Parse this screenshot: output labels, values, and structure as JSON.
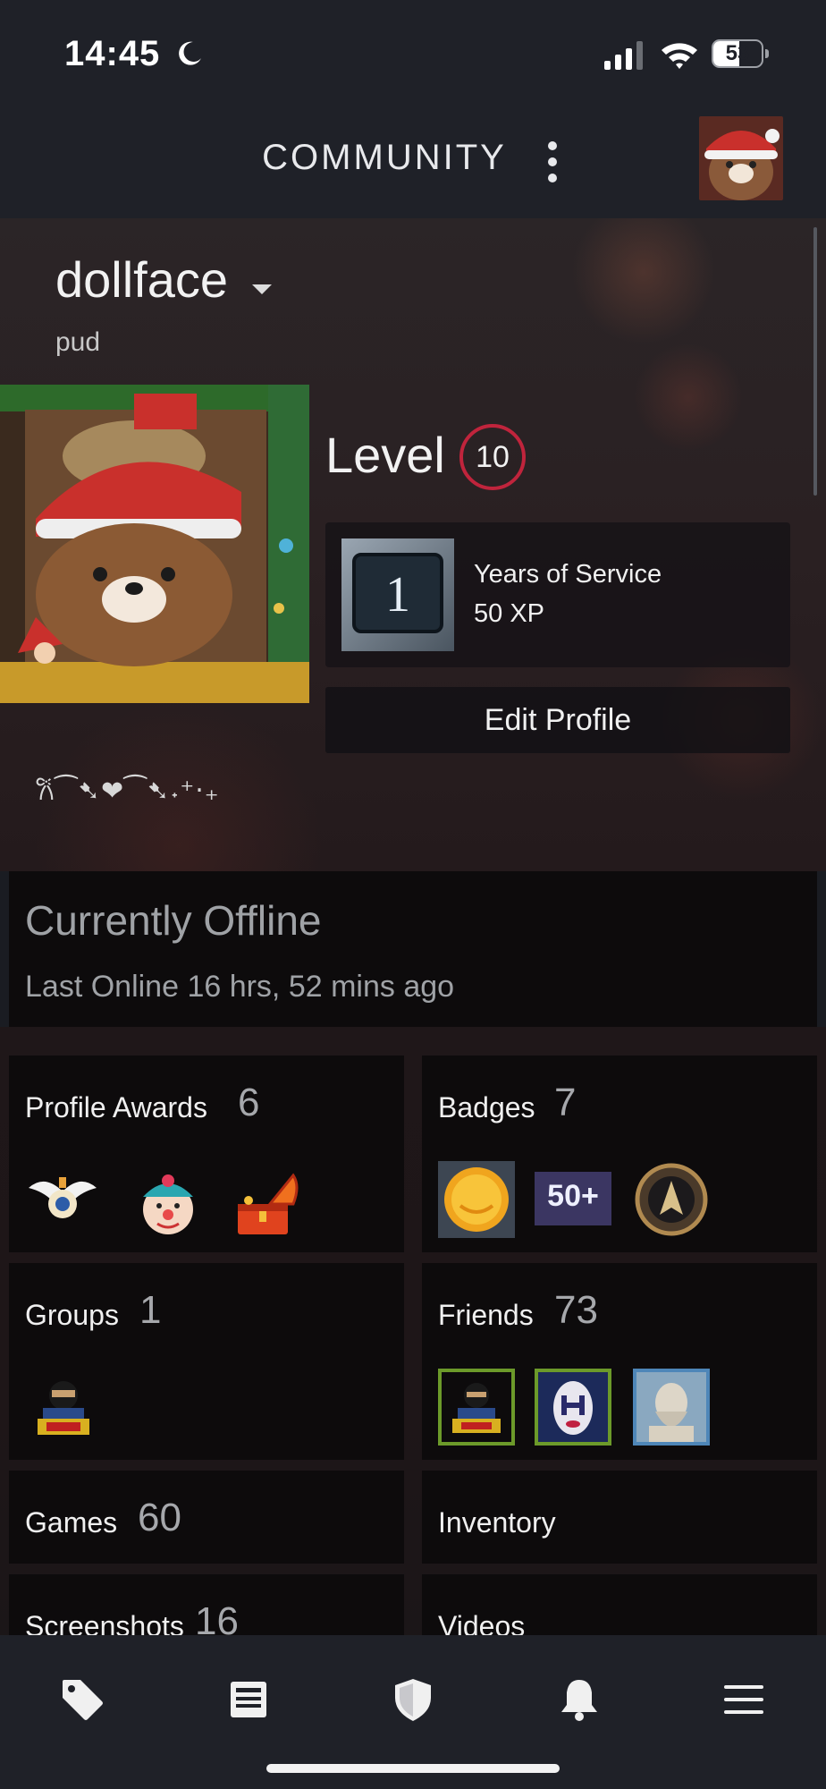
{
  "status_bar": {
    "time": "14:45",
    "battery": "53"
  },
  "header": {
    "title": "COMMUNITY"
  },
  "profile": {
    "username": "dollface",
    "real_name": "pud",
    "level_label": "Level",
    "level": "10",
    "badge": {
      "title": "Years of Service",
      "xp": "50 XP",
      "years": "1"
    },
    "edit_button": "Edit Profile",
    "summary": "𐙚⁀➷❤⁀➷˖⁺‧₊"
  },
  "presence": {
    "state": "Currently Offline",
    "last_online": "Last Online 16 hrs, 52 mins ago"
  },
  "tiles": {
    "awards": {
      "label": "Profile Awards",
      "count": "6"
    },
    "badges": {
      "label": "Badges",
      "count": "7",
      "badge_text": "50+"
    },
    "groups": {
      "label": "Groups",
      "count": "1"
    },
    "friends": {
      "label": "Friends",
      "count": "73"
    },
    "games": {
      "label": "Games",
      "count": "60"
    },
    "inventory": {
      "label": "Inventory"
    },
    "screenshots": {
      "label": "Screenshots",
      "count": "16"
    },
    "videos": {
      "label": "Videos"
    }
  },
  "colors": {
    "level_ring": "#c0243c",
    "accent_green": "#6c9a2a",
    "accent_blue": "#4e86b8"
  },
  "nav": [
    "tag-icon",
    "news-icon",
    "shield-icon",
    "bell-icon",
    "menu-icon"
  ]
}
